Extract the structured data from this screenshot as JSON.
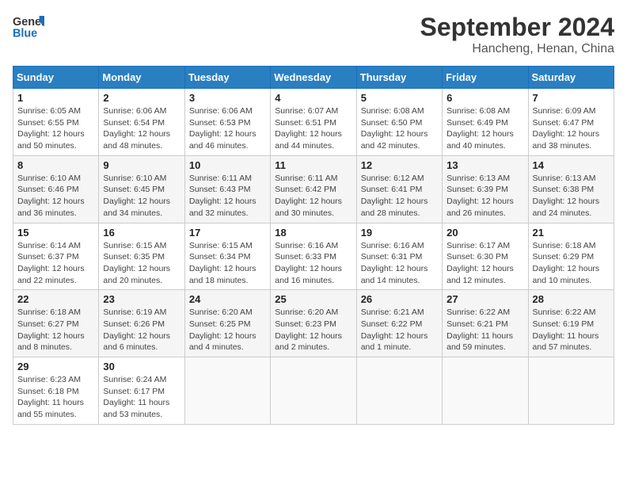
{
  "header": {
    "logo_line1": "General",
    "logo_line2": "Blue",
    "month": "September 2024",
    "location": "Hancheng, Henan, China"
  },
  "weekdays": [
    "Sunday",
    "Monday",
    "Tuesday",
    "Wednesday",
    "Thursday",
    "Friday",
    "Saturday"
  ],
  "weeks": [
    [
      {
        "day": "1",
        "info": "Sunrise: 6:05 AM\nSunset: 6:55 PM\nDaylight: 12 hours and 50 minutes."
      },
      {
        "day": "2",
        "info": "Sunrise: 6:06 AM\nSunset: 6:54 PM\nDaylight: 12 hours and 48 minutes."
      },
      {
        "day": "3",
        "info": "Sunrise: 6:06 AM\nSunset: 6:53 PM\nDaylight: 12 hours and 46 minutes."
      },
      {
        "day": "4",
        "info": "Sunrise: 6:07 AM\nSunset: 6:51 PM\nDaylight: 12 hours and 44 minutes."
      },
      {
        "day": "5",
        "info": "Sunrise: 6:08 AM\nSunset: 6:50 PM\nDaylight: 12 hours and 42 minutes."
      },
      {
        "day": "6",
        "info": "Sunrise: 6:08 AM\nSunset: 6:49 PM\nDaylight: 12 hours and 40 minutes."
      },
      {
        "day": "7",
        "info": "Sunrise: 6:09 AM\nSunset: 6:47 PM\nDaylight: 12 hours and 38 minutes."
      }
    ],
    [
      {
        "day": "8",
        "info": "Sunrise: 6:10 AM\nSunset: 6:46 PM\nDaylight: 12 hours and 36 minutes."
      },
      {
        "day": "9",
        "info": "Sunrise: 6:10 AM\nSunset: 6:45 PM\nDaylight: 12 hours and 34 minutes."
      },
      {
        "day": "10",
        "info": "Sunrise: 6:11 AM\nSunset: 6:43 PM\nDaylight: 12 hours and 32 minutes."
      },
      {
        "day": "11",
        "info": "Sunrise: 6:11 AM\nSunset: 6:42 PM\nDaylight: 12 hours and 30 minutes."
      },
      {
        "day": "12",
        "info": "Sunrise: 6:12 AM\nSunset: 6:41 PM\nDaylight: 12 hours and 28 minutes."
      },
      {
        "day": "13",
        "info": "Sunrise: 6:13 AM\nSunset: 6:39 PM\nDaylight: 12 hours and 26 minutes."
      },
      {
        "day": "14",
        "info": "Sunrise: 6:13 AM\nSunset: 6:38 PM\nDaylight: 12 hours and 24 minutes."
      }
    ],
    [
      {
        "day": "15",
        "info": "Sunrise: 6:14 AM\nSunset: 6:37 PM\nDaylight: 12 hours and 22 minutes."
      },
      {
        "day": "16",
        "info": "Sunrise: 6:15 AM\nSunset: 6:35 PM\nDaylight: 12 hours and 20 minutes."
      },
      {
        "day": "17",
        "info": "Sunrise: 6:15 AM\nSunset: 6:34 PM\nDaylight: 12 hours and 18 minutes."
      },
      {
        "day": "18",
        "info": "Sunrise: 6:16 AM\nSunset: 6:33 PM\nDaylight: 12 hours and 16 minutes."
      },
      {
        "day": "19",
        "info": "Sunrise: 6:16 AM\nSunset: 6:31 PM\nDaylight: 12 hours and 14 minutes."
      },
      {
        "day": "20",
        "info": "Sunrise: 6:17 AM\nSunset: 6:30 PM\nDaylight: 12 hours and 12 minutes."
      },
      {
        "day": "21",
        "info": "Sunrise: 6:18 AM\nSunset: 6:29 PM\nDaylight: 12 hours and 10 minutes."
      }
    ],
    [
      {
        "day": "22",
        "info": "Sunrise: 6:18 AM\nSunset: 6:27 PM\nDaylight: 12 hours and 8 minutes."
      },
      {
        "day": "23",
        "info": "Sunrise: 6:19 AM\nSunset: 6:26 PM\nDaylight: 12 hours and 6 minutes."
      },
      {
        "day": "24",
        "info": "Sunrise: 6:20 AM\nSunset: 6:25 PM\nDaylight: 12 hours and 4 minutes."
      },
      {
        "day": "25",
        "info": "Sunrise: 6:20 AM\nSunset: 6:23 PM\nDaylight: 12 hours and 2 minutes."
      },
      {
        "day": "26",
        "info": "Sunrise: 6:21 AM\nSunset: 6:22 PM\nDaylight: 12 hours and 1 minute."
      },
      {
        "day": "27",
        "info": "Sunrise: 6:22 AM\nSunset: 6:21 PM\nDaylight: 11 hours and 59 minutes."
      },
      {
        "day": "28",
        "info": "Sunrise: 6:22 AM\nSunset: 6:19 PM\nDaylight: 11 hours and 57 minutes."
      }
    ],
    [
      {
        "day": "29",
        "info": "Sunrise: 6:23 AM\nSunset: 6:18 PM\nDaylight: 11 hours and 55 minutes."
      },
      {
        "day": "30",
        "info": "Sunrise: 6:24 AM\nSunset: 6:17 PM\nDaylight: 11 hours and 53 minutes."
      },
      {
        "day": "",
        "info": ""
      },
      {
        "day": "",
        "info": ""
      },
      {
        "day": "",
        "info": ""
      },
      {
        "day": "",
        "info": ""
      },
      {
        "day": "",
        "info": ""
      }
    ]
  ]
}
